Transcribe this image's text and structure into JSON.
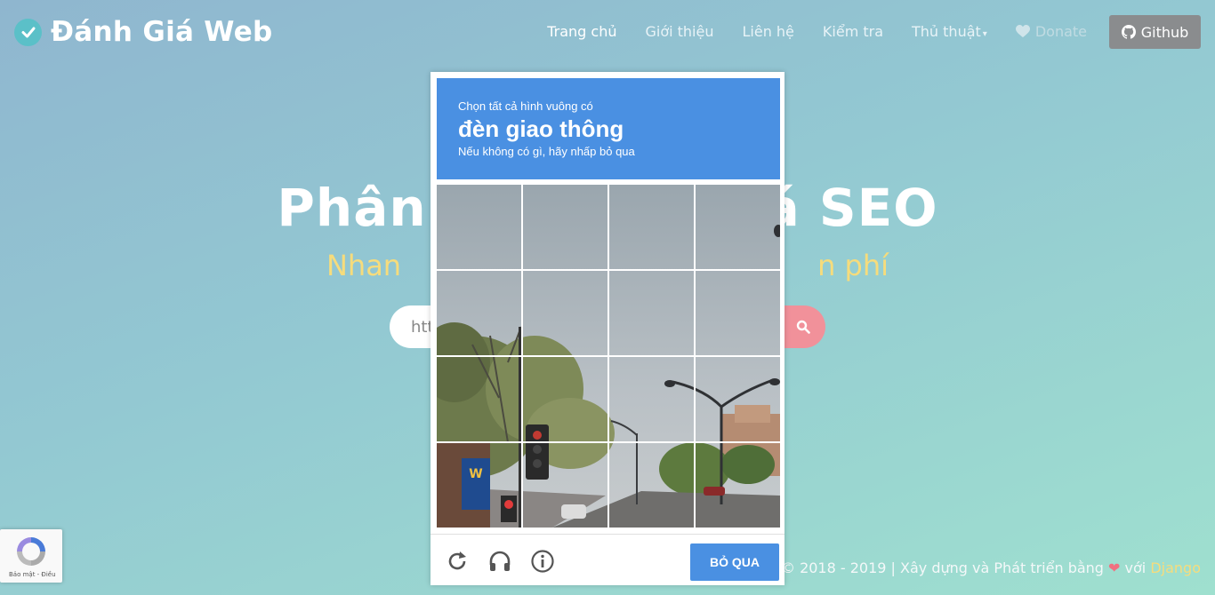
{
  "brand": {
    "name": "Đánh Giá Web"
  },
  "nav": {
    "items": [
      {
        "label": "Trang chủ"
      },
      {
        "label": "Giới thiệu"
      },
      {
        "label": "Liên hệ"
      },
      {
        "label": "Kiểm tra"
      },
      {
        "label": "Thủ thuật"
      },
      {
        "label": "Donate"
      }
    ],
    "github_label": "Github"
  },
  "hero": {
    "title_left": "Phân t",
    "title_right": "á SEO",
    "subtitle_left": "Nhan",
    "subtitle_right": "n phí",
    "search_partial": "htt"
  },
  "footer": {
    "text_before": "© 2018 - 2019 | Xây dựng và Phát triển bằng",
    "text_with": "với",
    "django": "Django"
  },
  "recaptcha_badge": {
    "text": "Bảo mật - Điều"
  },
  "captcha": {
    "instruction": "Chọn tất cả hình vuông có",
    "target": "đèn giao thông",
    "hint": "Nếu không có gì, hãy nhấp bỏ qua",
    "skip_label": "BỎ QUA",
    "grid_rows": 4,
    "grid_cols": 4,
    "colors": {
      "header": "#4a90e2",
      "button": "#4a90e2"
    }
  },
  "icons": {
    "brand": "check-circle-icon",
    "heart": "heart-icon",
    "github": "github-icon",
    "search": "search-icon",
    "reload": "reload-icon",
    "audio": "headphones-icon",
    "info": "info-icon"
  }
}
